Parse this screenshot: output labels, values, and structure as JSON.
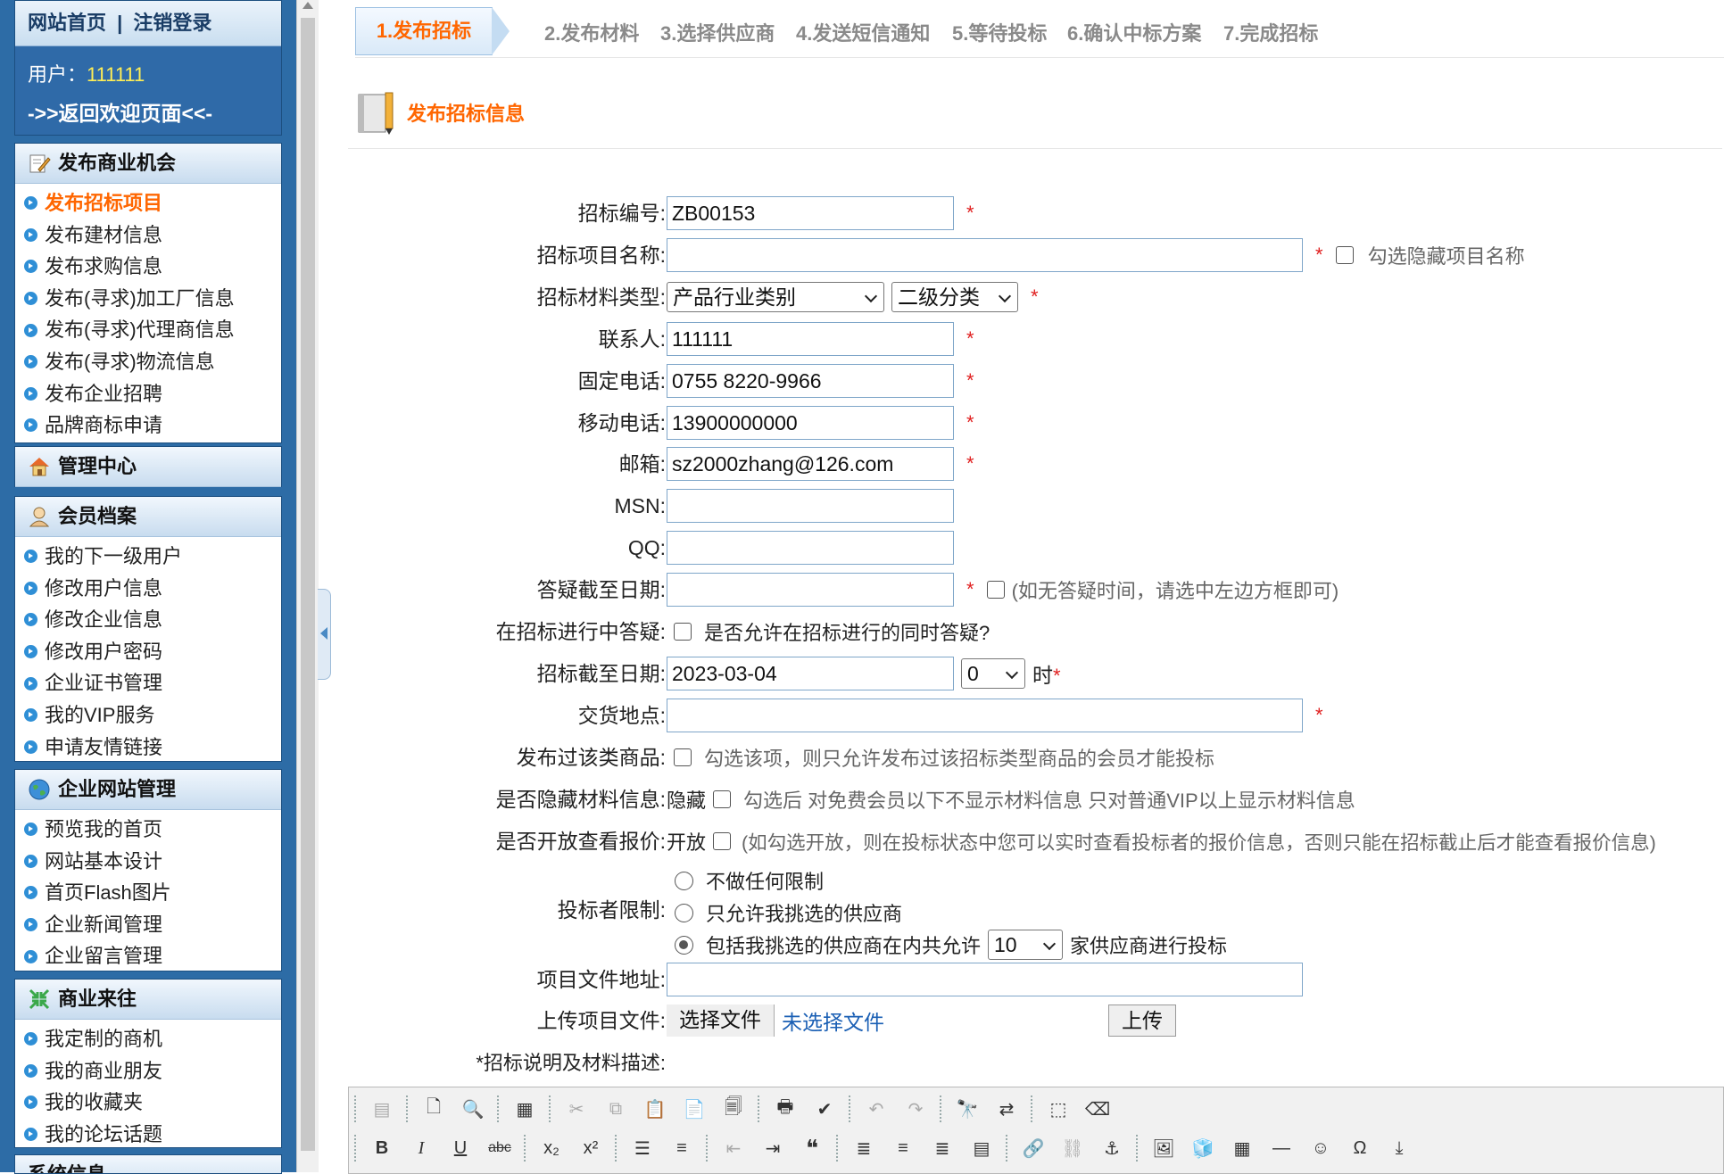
{
  "sidebar": {
    "top": {
      "home": "网站首页",
      "sep": "|",
      "logout": "注销登录",
      "user_label": "用户：",
      "user_id": "111111",
      "back": "->>返回欢迎页面<<-"
    },
    "sections": [
      {
        "title": "发布商业机会",
        "icon": "edit-icon",
        "items": [
          "发布招标项目",
          "发布建材信息",
          "发布求购信息",
          "发布(寻求)加工厂信息",
          "发布(寻求)代理商信息",
          "发布(寻求)物流信息",
          "发布企业招聘",
          "品牌商标申请"
        ]
      },
      {
        "title": "管理中心",
        "icon": "home-icon",
        "items": []
      },
      {
        "title": "会员档案",
        "icon": "user-icon",
        "items": [
          "我的下一级用户",
          "修改用户信息",
          "修改企业信息",
          "修改用户密码",
          "企业证书管理",
          "我的VIP服务",
          "申请友情链接"
        ]
      },
      {
        "title": "企业网站管理",
        "icon": "globe-icon",
        "items": [
          "预览我的首页",
          "网站基本设计",
          "首页Flash图片",
          "企业新闻管理",
          "企业留言管理"
        ]
      },
      {
        "title": "商业来往",
        "icon": "exchange-icon",
        "items": [
          "我定制的商机",
          "我的商业朋友",
          "我的收藏夹",
          "我的论坛话题"
        ]
      },
      {
        "title": "系统信息",
        "icon": "info-icon",
        "items": []
      }
    ]
  },
  "steps": [
    "1.发布招标",
    "2.发布材料",
    "3.选择供应商",
    "4.发送短信通知",
    "5.等待投标",
    "6.确认中标方案",
    "7.完成招标"
  ],
  "page_title": "发布招标信息",
  "form": {
    "bid_no": {
      "label": "招标编号:",
      "value": "ZB00153"
    },
    "project_name": {
      "label": "招标项目名称:",
      "value": "",
      "hide_hint": "勾选隐藏项目名称"
    },
    "material_type": {
      "label": "招标材料类型:",
      "sel1": "产品行业类别",
      "sel2": "二级分类"
    },
    "contact": {
      "label": "联系人:",
      "value": "111111"
    },
    "phone": {
      "label": "固定电话:",
      "value": "0755 8220-9966"
    },
    "mobile": {
      "label": "移动电话:",
      "value": "13900000000"
    },
    "email": {
      "label": "邮箱:",
      "value": "sz2000zhang@126.com"
    },
    "msn": {
      "label": "MSN:",
      "value": ""
    },
    "qq": {
      "label": "QQ:",
      "value": ""
    },
    "qa_deadline": {
      "label": "答疑截至日期:",
      "value": "",
      "hint": "(如无答疑时间，请选中左边方框即可)"
    },
    "qa_during": {
      "label": "在招标进行中答疑:",
      "hint": "是否允许在招标进行的同时答疑?"
    },
    "bid_deadline": {
      "label": "招标截至日期:",
      "value": "2023-03-04",
      "hour": "0",
      "hour_unit": "时"
    },
    "delivery": {
      "label": "交货地点:",
      "value": ""
    },
    "published_goods": {
      "label": "发布过该类商品:",
      "hint": "勾选该项，则只允许发布过该招标类型商品的会员才能投标"
    },
    "hide_material": {
      "label": "是否隐藏材料信息:",
      "prefix": "隐藏",
      "hint": "勾选后 对免费会员以下不显示材料信息 只对普通VIP以上显示材料信息"
    },
    "open_quote": {
      "label": "是否开放查看报价:",
      "prefix": "开放",
      "hint": "(如勾选开放，则在投标状态中您可以实时查看投标者的报价信息，否则只能在招标截止后才能查看报价信息)"
    },
    "bidder_limit": {
      "label": "投标者限制:",
      "opt1": "不做任何限制",
      "opt2": "只允许我挑选的供应商",
      "opt3_pre": "包括我挑选的供应商在内共允许",
      "count": "10",
      "opt3_post": "家供应商进行投标"
    },
    "file_url": {
      "label": "项目文件地址:",
      "value": ""
    },
    "upload": {
      "label": "上传项目文件:",
      "choose": "选择文件",
      "none": "未选择文件",
      "btn": "上传"
    },
    "desc_label": "*招标说明及材料描述:",
    "required_mark": "*"
  },
  "colors": {
    "accent": "#ff6600",
    "sidebar": "#2d6ca6",
    "link": "#1a5fb4",
    "required": "#e02020"
  }
}
